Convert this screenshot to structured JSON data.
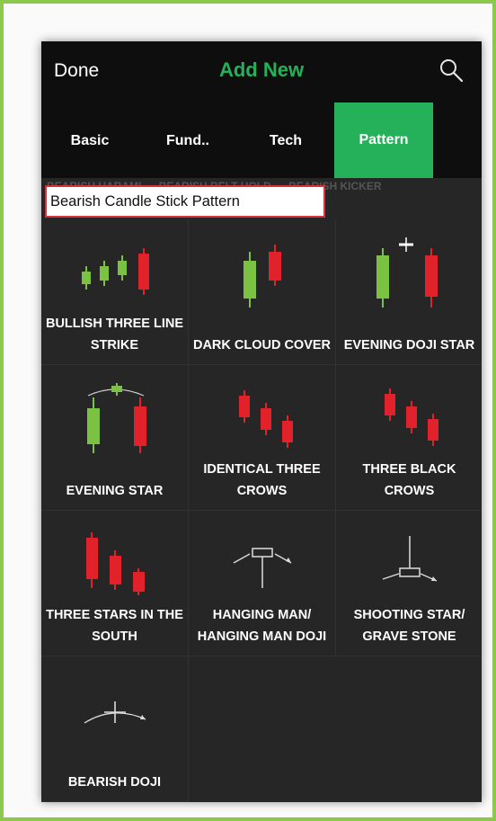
{
  "header": {
    "done_label": "Done",
    "title": "Add New",
    "search_icon": "search-icon"
  },
  "tabs": [
    {
      "label": "Basic",
      "active": false
    },
    {
      "label": "Fund..",
      "active": false
    },
    {
      "label": "Tech",
      "active": false
    },
    {
      "label": "Pattern",
      "active": true
    }
  ],
  "section": {
    "title": "Bearish Candle Stick Pattern",
    "scroll_labels": [
      "BEARISH HARAMI",
      "BEARISH BELT HOLD",
      "BEARISH KICKER"
    ]
  },
  "patterns": [
    {
      "name": "BULLISH THREE LINE\nSTRIKE",
      "icon": "bullish-three-line-strike-icon"
    },
    {
      "name": "DARK CLOUD COVER",
      "icon": "dark-cloud-cover-icon"
    },
    {
      "name": "EVENING DOJI STAR",
      "icon": "evening-doji-star-icon"
    },
    {
      "name": "EVENING STAR",
      "icon": "evening-star-icon"
    },
    {
      "name": "IDENTICAL THREE\nCROWS",
      "icon": "identical-three-crows-icon"
    },
    {
      "name": "THREE BLACK\nCROWS",
      "icon": "three-black-crows-icon"
    },
    {
      "name": "THREE STARS IN THE\nSOUTH",
      "icon": "three-stars-in-the-south-icon"
    },
    {
      "name": "HANGING MAN/\nHANGING MAN DOJI",
      "icon": "hanging-man-icon"
    },
    {
      "name": "SHOOTING STAR/\nGRAVE STONE",
      "icon": "shooting-star-icon"
    },
    {
      "name": "BEARISH DOJI",
      "icon": "bearish-doji-icon"
    }
  ],
  "colors": {
    "accent": "#25b05a",
    "bullish_candle": "#7cc242",
    "bearish_candle": "#e1222b",
    "highlight_border": "#d9303a",
    "frame_border": "#8cc84b"
  }
}
